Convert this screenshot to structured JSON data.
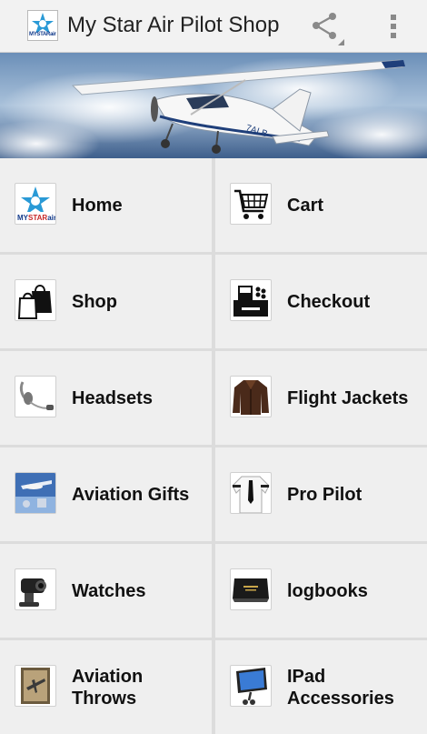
{
  "app": {
    "title": "My Star Air Pilot Shop",
    "logo_text": "MYSTARair",
    "share_icon": "share-icon",
    "overflow_icon": "overflow-menu-icon"
  },
  "banner": {
    "tail_text": "7ALB"
  },
  "tiles": [
    {
      "label": "Home",
      "icon": "mystarair-logo-icon"
    },
    {
      "label": "Cart",
      "icon": "shopping-cart-icon"
    },
    {
      "label": "Shop",
      "icon": "shopping-bags-icon"
    },
    {
      "label": "Checkout",
      "icon": "cash-register-icon"
    },
    {
      "label": "Headsets",
      "icon": "headset-icon"
    },
    {
      "label": "Flight Jackets",
      "icon": "flight-jacket-icon"
    },
    {
      "label": "Aviation Gifts",
      "icon": "aviation-gifts-icon"
    },
    {
      "label": "Pro Pilot",
      "icon": "pilot-shirt-icon"
    },
    {
      "label": "Watches",
      "icon": "watch-camera-icon"
    },
    {
      "label": "logbooks",
      "icon": "logbook-icon"
    },
    {
      "label": "Aviation Throws",
      "icon": "aviation-throw-icon"
    },
    {
      "label": "IPad Accessories",
      "icon": "ipad-mount-icon"
    }
  ]
}
